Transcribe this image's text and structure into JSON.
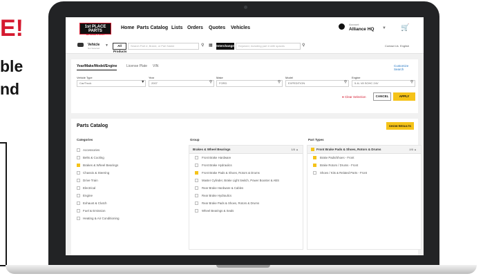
{
  "promo": {
    "headline": "E!",
    "lines": [
      "ble",
      "nd"
    ]
  },
  "nav": {
    "logo_main": "1st PLACE PARTS",
    "logo_sub": "WE MAKE IT EASY",
    "items": [
      "Home",
      "Parts Catalog",
      "Lists",
      "Orders",
      "Quotes",
      "Vehicles"
    ],
    "account_small": "Account",
    "account_name": "Alliance HQ"
  },
  "searchbar": {
    "vehicle_label": "Vehicle",
    "vehicle_sub": "Not Selected",
    "scope": "All Products",
    "search_placeholder": "Search Part #, Brand, or Part Name",
    "interchange": "Interchange",
    "interchange_placeholder": "Keyword, including part # with spaces",
    "contact": "Contact Us",
    "language": "English"
  },
  "vehicle": {
    "tabs": [
      "Year/Make/Model/Engine",
      "License Plate",
      "VIN"
    ],
    "customize": "Customize Search",
    "fields": [
      {
        "label": "Vehicle Type",
        "value": "Car/Truck"
      },
      {
        "label": "Year",
        "value": "2007"
      },
      {
        "label": "Make",
        "value": "FORD"
      },
      {
        "label": "Model",
        "value": "EXPEDITION"
      },
      {
        "label": "Engine",
        "value": "5.4L V8 SOHC 24V"
      }
    ],
    "clear": "Clear Selection",
    "cancel": "CANCEL",
    "apply": "APPLY"
  },
  "parts": {
    "title": "Parts Catalog",
    "show_results": "SHOW RESULTS",
    "columns": [
      "Categories",
      "Group",
      "Part Types"
    ],
    "categories": [
      {
        "label": "Accessories",
        "checked": false
      },
      {
        "label": "Belts & Cooling",
        "checked": false
      },
      {
        "label": "Brakes & Wheel Bearings",
        "checked": true
      },
      {
        "label": "Chassis & Steering",
        "checked": false
      },
      {
        "label": "Drive Train",
        "checked": false
      },
      {
        "label": "Electrical",
        "checked": false
      },
      {
        "label": "Engine",
        "checked": false
      },
      {
        "label": "Exhaust & Clutch",
        "checked": false
      },
      {
        "label": "Fuel & Emission",
        "checked": false
      },
      {
        "label": "Heating & Air Conditioning",
        "checked": false
      }
    ],
    "group_title": "Brakes & Wheel Bearings",
    "group_count": "1/3",
    "groups": [
      {
        "label": "Front Brake Hardware",
        "checked": false
      },
      {
        "label": "Front Brake Hydraulics",
        "checked": false
      },
      {
        "label": "Front Brake Pads & Shoes, Rotors & Drums",
        "checked": true
      },
      {
        "label": "Master Cylinder, Brake Light Switch, Power Booster & ABS",
        "checked": false
      },
      {
        "label": "Rear Brake Hardware & Cables",
        "checked": false
      },
      {
        "label": "Rear Brake Hydraulics",
        "checked": false
      },
      {
        "label": "Rear Brake Pads & Shoes, Rotors & Drums",
        "checked": false
      },
      {
        "label": "Wheel Bearings & Seals",
        "checked": false
      }
    ],
    "type_title": "Front Brake Pads & Shoes, Rotors & Drums",
    "type_count": "2/3",
    "types": [
      {
        "label": "Brake Pads/Shoes - Front",
        "checked": true
      },
      {
        "label": "Brake Rotors / Drums - Front",
        "checked": true
      },
      {
        "label": "Shoes / Kits & Related Parts - Front",
        "checked": false
      }
    ]
  },
  "colors": {
    "accent": "#f5c319",
    "brand_red": "#d5192f",
    "bezel": "#222325",
    "link": "#2878c3"
  }
}
